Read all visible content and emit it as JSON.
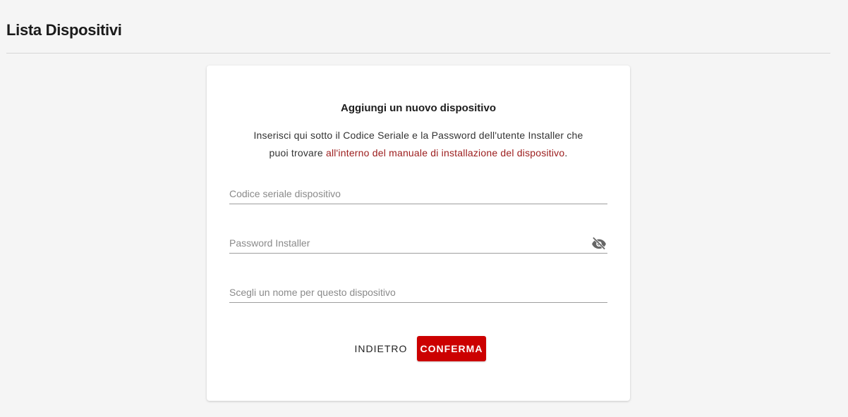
{
  "header": {
    "title": "Lista Dispositivi"
  },
  "card": {
    "title": "Aggiungi un nuovo dispositivo",
    "desc_line1": "Inserisci qui sotto il Codice Seriale e la Password dell'utente Installer che",
    "desc_line2_prefix": "puoi trovare ",
    "desc_link": "all'interno del manuale di installazione del dispositivo",
    "desc_suffix": "."
  },
  "form": {
    "serial": {
      "placeholder": "Codice seriale dispositivo",
      "value": ""
    },
    "password": {
      "placeholder": "Password Installer",
      "value": "",
      "toggle_icon": "eye-off-icon"
    },
    "name": {
      "placeholder": "Scegli un nome per questo dispositivo",
      "value": ""
    }
  },
  "actions": {
    "back_label": "INDIETRO",
    "confirm_label": "CONFERMA"
  },
  "colors": {
    "accent": "#cc0000",
    "link": "#9b1b1b",
    "background": "#f5f5f5"
  }
}
